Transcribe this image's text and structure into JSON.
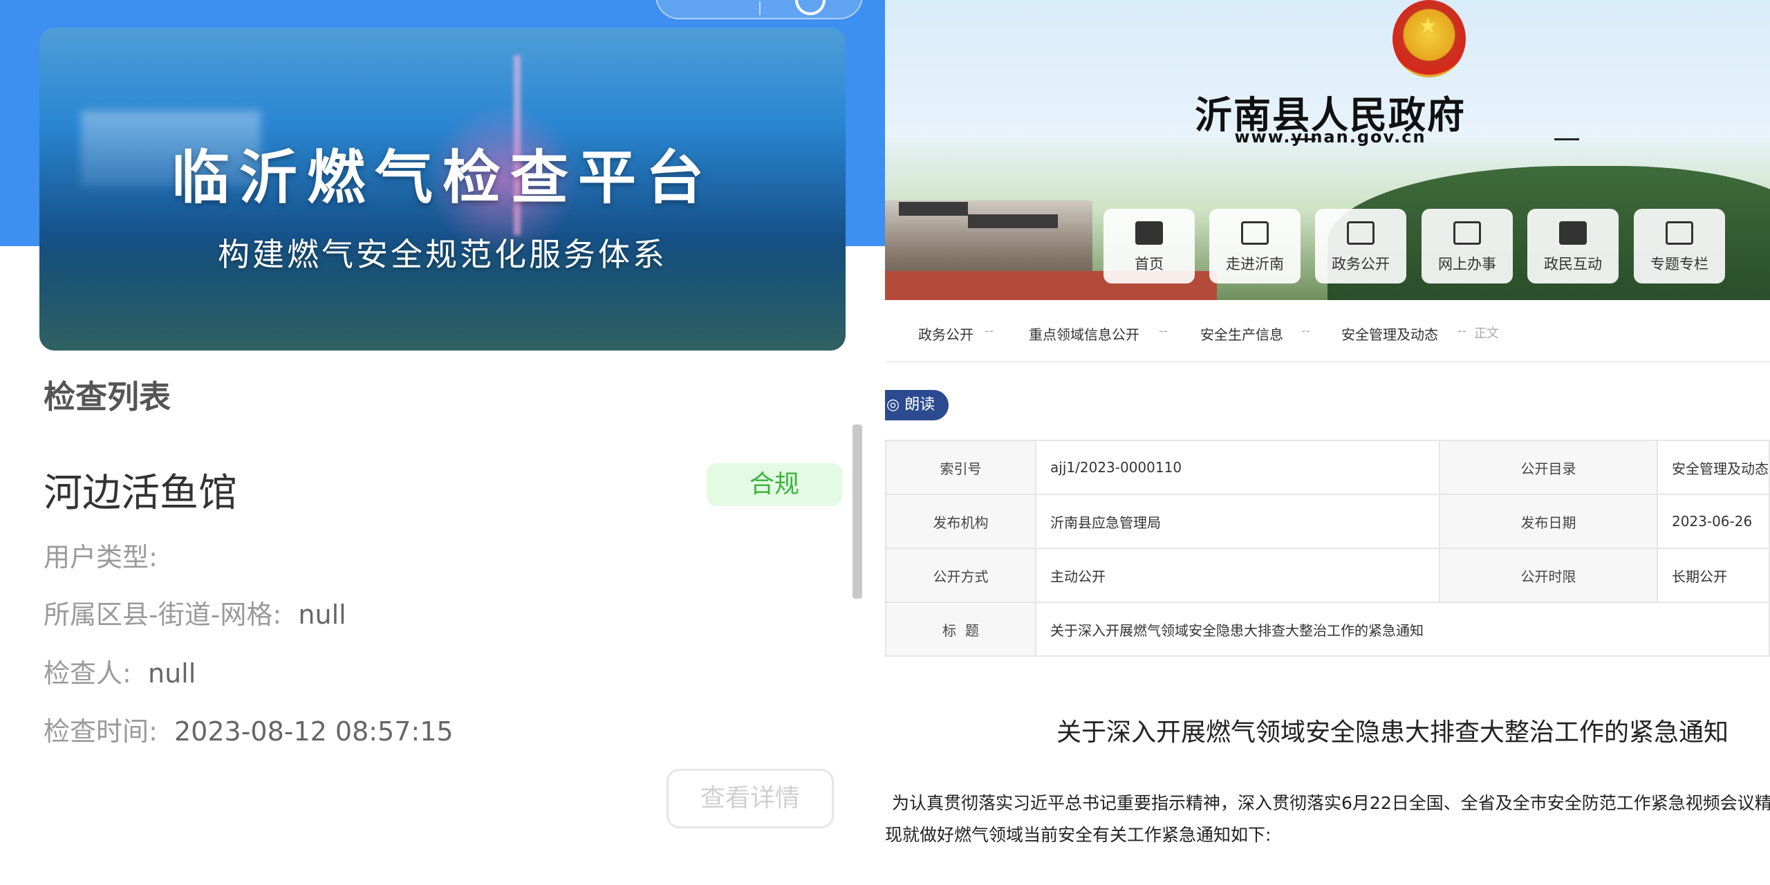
{
  "app": {
    "banner": {
      "title": "临沂燃气检查平台",
      "subtitle": "构建燃气安全规范化服务体系"
    },
    "list_heading": "检查列表",
    "card": {
      "name": "河边活鱼馆",
      "status": "合规",
      "status_color": "#3fb33f",
      "fields": [
        {
          "label": "用户类型:",
          "value": ""
        },
        {
          "label": "所属区县-街道-网格:",
          "value": "null"
        },
        {
          "label": "检查人:",
          "value": "null"
        },
        {
          "label": "检查时间:",
          "value": "2023-08-12 08:57:15"
        }
      ],
      "detail_button": "查看详情"
    }
  },
  "gov": {
    "site_name": "沂南县人民政府",
    "url": "www.yinan.gov.cn",
    "nav": [
      {
        "label": "首页",
        "icon": "home-icon"
      },
      {
        "label": "走进沂南",
        "icon": "document-icon"
      },
      {
        "label": "政务公开",
        "icon": "document-search-icon"
      },
      {
        "label": "网上办事",
        "icon": "service-icon"
      },
      {
        "label": "政民互动",
        "icon": "books-icon"
      },
      {
        "label": "专题专栏",
        "icon": "grid-icon"
      }
    ],
    "breadcrumb": [
      "政务公开",
      "重点领域信息公开",
      "安全生产信息",
      "安全管理及动态"
    ],
    "breadcrumb_sep": "--",
    "breadcrumb_current": "正文",
    "read_button": "朗读",
    "meta": {
      "row1": {
        "k1": "索引号",
        "v1": "ajj1/2023-0000110",
        "k2": "公开目录",
        "v2": "安全管理及动态"
      },
      "row2": {
        "k1": "发布机构",
        "v1": "沂南县应急管理局",
        "k2": "发布日期",
        "v2": "2023-06-26"
      },
      "row3": {
        "k1": "公开方式",
        "v1": "主动公开",
        "k2": "公开时限",
        "v2": "长期公开"
      },
      "row4": {
        "k1": "标  题",
        "v1": "关于深入开展燃气领域安全隐患大排查大整治工作的紧急通知"
      }
    },
    "article": {
      "title": "关于深入开展燃气领域安全隐患大排查大整治工作的紧急通知",
      "p1": "为认真贯彻落实习近平总书记重要指示精神，深入贯彻落实6月22日全国、全省及全市安全防范工作紧急视频会议精神，",
      "p2": "现就做好燃气领域当前安全有关工作紧急通知如下:"
    },
    "colors": {
      "read_button": "#2b4a8f",
      "app_blue": "#3d8ff0"
    }
  }
}
